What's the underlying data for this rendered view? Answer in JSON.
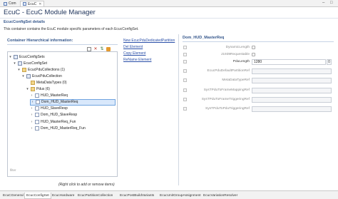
{
  "top_tabs": [
    {
      "label": "Com",
      "active": false
    },
    {
      "label": "EcuC",
      "active": true
    }
  ],
  "title": "EcuC - EcuC Module Manager",
  "details": {
    "header": "EcucConfigSet details",
    "description": "This container contains the EcuC module specific parameters of each EcucConfigSet."
  },
  "hierarchy": {
    "header": "Container Hierarchical information:",
    "filter_placeholder": "filter",
    "hint": "(Right click to add or remove items)",
    "tree": [
      {
        "label": "EcucConfigSets",
        "level": 0,
        "twist": "▾",
        "icon": "node",
        "selected": false
      },
      {
        "label": "EcucConfigSet",
        "level": 1,
        "twist": "▾",
        "icon": "node",
        "selected": false
      },
      {
        "label": "EcucPduCollections (1)",
        "level": 2,
        "twist": "▾",
        "icon": "folder",
        "selected": false
      },
      {
        "label": "EcucPduCollection",
        "level": 3,
        "twist": "▾",
        "icon": "node",
        "selected": false
      },
      {
        "label": "MetaDataTypes (0)",
        "level": 4,
        "twist": "",
        "icon": "folder",
        "selected": false
      },
      {
        "label": "Pdus (6)",
        "level": 4,
        "twist": "▾",
        "icon": "folder",
        "selected": false
      },
      {
        "label": "HUD_MasterReq",
        "level": 5,
        "twist": "›",
        "icon": "item",
        "selected": false
      },
      {
        "label": "Dom_HUD_MasterReq",
        "level": 5,
        "twist": "›",
        "icon": "item",
        "selected": true
      },
      {
        "label": "HUD_SlaveResp",
        "level": 5,
        "twist": "›",
        "icon": "item",
        "selected": false
      },
      {
        "label": "Dom_HUD_SlaveResp",
        "level": 5,
        "twist": "›",
        "icon": "item",
        "selected": false
      },
      {
        "label": "HUD_MasterReq_Fun",
        "level": 5,
        "twist": "›",
        "icon": "item",
        "selected": false
      },
      {
        "label": "Dom_HUD_MasterReq_Fun",
        "level": 5,
        "twist": "›",
        "icon": "item",
        "selected": false
      }
    ]
  },
  "actions": {
    "new_link": "New EcucPduDedicatedPartition",
    "del_link": "Del Element",
    "copy_link": "Copy Element",
    "rename_link": "ReName Element"
  },
  "properties": {
    "header": "Dom_HUD_MasterReq",
    "rows": [
      {
        "label": "DynamicLength",
        "kind": "check",
        "enabled": false
      },
      {
        "label": "J1939Requestable",
        "kind": "check",
        "enabled": false
      },
      {
        "label": "PduLength",
        "kind": "number",
        "enabled": true,
        "value": "1280",
        "spin": "0"
      },
      {
        "label": "EcucPduDefaultPartitionRef",
        "kind": "field",
        "enabled": false,
        "value": ""
      },
      {
        "label": "MetaDataTypeRef",
        "kind": "field",
        "enabled": false,
        "value": ""
      },
      {
        "label": "SysTPduToFrameMappingRef",
        "kind": "field",
        "enabled": false,
        "value": ""
      },
      {
        "label": "SysTPduToFrameTriggeringRef",
        "kind": "field",
        "enabled": false,
        "value": ""
      },
      {
        "label": "SysTPduToPduTriggeringRef",
        "kind": "field",
        "enabled": false,
        "value": ""
      }
    ]
  },
  "bottom_tabs": [
    {
      "label": "EcuCGeneral",
      "active": false
    },
    {
      "label": "EcucConfigSet",
      "active": true
    },
    {
      "label": "EcucHardware",
      "active": false
    },
    {
      "label": "EcucPartitionCollection",
      "active": false
    },
    {
      "label": "EcucPostBuildVariants",
      "active": false
    },
    {
      "label": "EcucUnitGroupAssignment",
      "active": false
    },
    {
      "label": "EcucVariationResolver",
      "active": false
    }
  ],
  "colors": {
    "accent": "#34568b",
    "selection": "#d9e8fb",
    "link": "#2a4fa8"
  }
}
